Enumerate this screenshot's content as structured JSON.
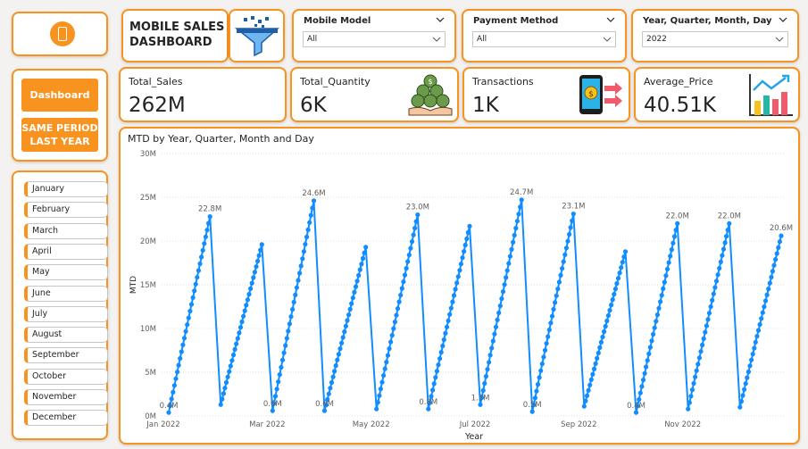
{
  "header": {
    "title_line1": "MOBILE SALES",
    "title_line2": "DASHBOARD"
  },
  "icons": {
    "phone": "phone-icon",
    "filter": "filter-funnel-icon",
    "coins": "coins-hand-icon",
    "transactions": "phone-money-transfer-icon",
    "price": "bar-chart-growth-icon"
  },
  "nav": {
    "dashboard": "Dashboard",
    "same_period_line1": "SAME PERIOD",
    "same_period_line2": "LAST YEAR"
  },
  "slicers": [
    {
      "title": "Mobile Model",
      "value": "All"
    },
    {
      "title": "Payment Method",
      "value": "All"
    },
    {
      "title": "Year, Quarter, Month, Day",
      "value": "2022"
    }
  ],
  "kpis": [
    {
      "label": "Total_Sales",
      "value": "262M"
    },
    {
      "label": "Total_Quantity",
      "value": "6K"
    },
    {
      "label": "Transactions",
      "value": "1K"
    },
    {
      "label": "Average_Price",
      "value": "40.51K"
    }
  ],
  "months": [
    "January",
    "February",
    "March",
    "April",
    "May",
    "June",
    "July",
    "August",
    "September",
    "October",
    "November",
    "December"
  ],
  "colors": {
    "accent": "#f7931e",
    "series": "#118dff",
    "background": "#f3f2f1"
  },
  "chart_data": {
    "type": "line",
    "title": "MTD by Year, Quarter, Month and Day",
    "xlabel": "Year",
    "ylabel": "MTD",
    "ylim": [
      0,
      30
    ],
    "y_unit": "M",
    "yticks": [
      "0M",
      "5M",
      "10M",
      "15M",
      "20M",
      "25M",
      "30M"
    ],
    "xticks": [
      "Jan 2022",
      "Mar 2022",
      "May 2022",
      "Jul 2022",
      "Sep 2022",
      "Nov 2022"
    ],
    "grid": true,
    "legend": "none",
    "series": [
      {
        "months": [
          {
            "month": "Jan",
            "start": 0.4,
            "end": 22.8,
            "start_label": "0.4M",
            "end_label": "22.8M"
          },
          {
            "month": "Feb",
            "start": 1.3,
            "end": 19.6
          },
          {
            "month": "Mar",
            "start": 0.6,
            "end": 24.6,
            "start_label": "0.6M",
            "end_label": "24.6M"
          },
          {
            "month": "Apr",
            "start": 0.6,
            "end": 19.3,
            "start_label": "0.6M"
          },
          {
            "month": "May",
            "start": 0.8,
            "end": 23.0,
            "end_label": "23.0M"
          },
          {
            "month": "Jun",
            "start": 0.8,
            "end": 21.7,
            "start_label": "0.8M"
          },
          {
            "month": "Jul",
            "start": 1.3,
            "end": 24.7,
            "start_label": "1.3M",
            "end_label": "24.7M"
          },
          {
            "month": "Aug",
            "start": 0.5,
            "end": 23.1,
            "start_label": "0.5M",
            "end_label": "23.1M"
          },
          {
            "month": "Sep",
            "start": 1.1,
            "end": 18.8
          },
          {
            "month": "Oct",
            "start": 0.4,
            "end": 22.0,
            "start_label": "0.4M",
            "end_label": "22.0M"
          },
          {
            "month": "Nov",
            "start": 0.8,
            "end": 22.0,
            "end_label": "22.0M"
          },
          {
            "month": "Dec",
            "start": 1.0,
            "end": 20.6,
            "end_label": "20.6M"
          }
        ]
      }
    ]
  }
}
